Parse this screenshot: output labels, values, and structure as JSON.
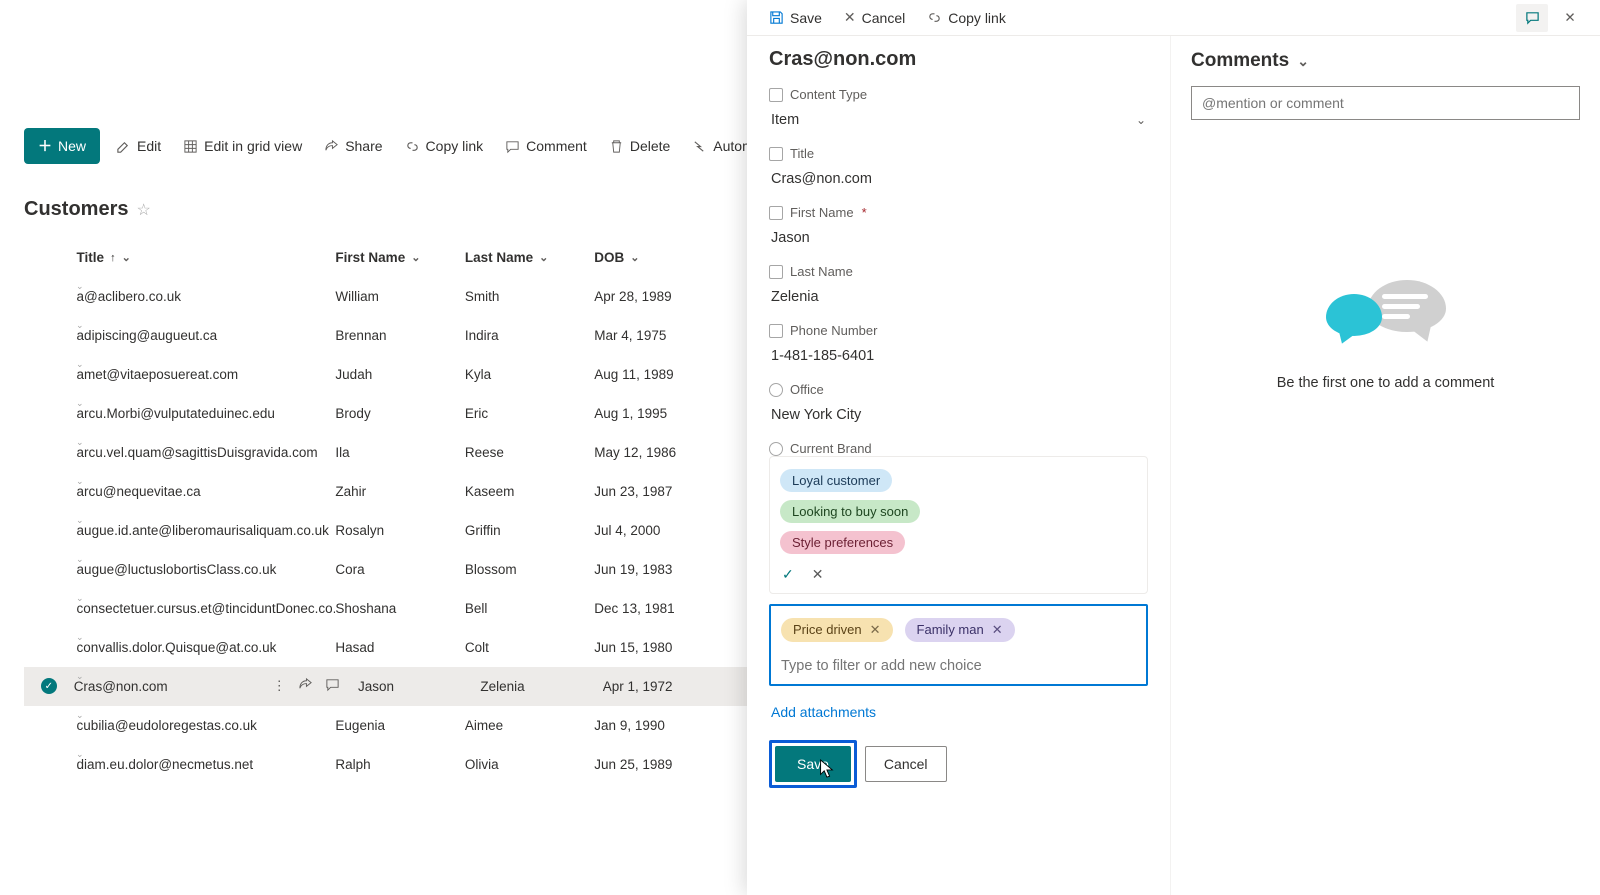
{
  "toolbar": {
    "new_label": "New",
    "edit_label": "Edit",
    "grid_label": "Edit in grid view",
    "share_label": "Share",
    "copylink_label": "Copy link",
    "comment_label": "Comment",
    "delete_label": "Delete",
    "automate_label": "Automate"
  },
  "list": {
    "title": "Customers",
    "columns": {
      "title": "Title",
      "first_name": "First Name",
      "last_name": "Last Name",
      "dob": "DOB"
    },
    "rows": [
      {
        "title": "a@aclibero.co.uk",
        "first_name": "William",
        "last_name": "Smith",
        "dob": "Apr 28, 1989"
      },
      {
        "title": "adipiscing@augueut.ca",
        "first_name": "Brennan",
        "last_name": "Indira",
        "dob": "Mar 4, 1975"
      },
      {
        "title": "amet@vitaeposuereat.com",
        "first_name": "Judah",
        "last_name": "Kyla",
        "dob": "Aug 11, 1989"
      },
      {
        "title": "arcu.Morbi@vulputateduinec.edu",
        "first_name": "Brody",
        "last_name": "Eric",
        "dob": "Aug 1, 1995"
      },
      {
        "title": "arcu.vel.quam@sagittisDuisgravida.com",
        "first_name": "Ila",
        "last_name": "Reese",
        "dob": "May 12, 1986"
      },
      {
        "title": "arcu@nequevitae.ca",
        "first_name": "Zahir",
        "last_name": "Kaseem",
        "dob": "Jun 23, 1987"
      },
      {
        "title": "augue.id.ante@liberomaurisaliquam.co.uk",
        "first_name": "Rosalyn",
        "last_name": "Griffin",
        "dob": "Jul 4, 2000"
      },
      {
        "title": "augue@luctuslobortisClass.co.uk",
        "first_name": "Cora",
        "last_name": "Blossom",
        "dob": "Jun 19, 1983"
      },
      {
        "title": "consectetuer.cursus.et@tinciduntDonec.co.uk",
        "first_name": "Shoshana",
        "last_name": "Bell",
        "dob": "Dec 13, 1981"
      },
      {
        "title": "convallis.dolor.Quisque@at.co.uk",
        "first_name": "Hasad",
        "last_name": "Colt",
        "dob": "Jun 15, 1980"
      },
      {
        "title": "Cras@non.com",
        "first_name": "Jason",
        "last_name": "Zelenia",
        "dob": "Apr 1, 1972",
        "selected": true
      },
      {
        "title": "cubilia@eudoloregestas.co.uk",
        "first_name": "Eugenia",
        "last_name": "Aimee",
        "dob": "Jan 9, 1990"
      },
      {
        "title": "diam.eu.dolor@necmetus.net",
        "first_name": "Ralph",
        "last_name": "Olivia",
        "dob": "Jun 25, 1989"
      }
    ]
  },
  "panel": {
    "top": {
      "save_label": "Save",
      "cancel_label": "Cancel",
      "copylink_label": "Copy link"
    },
    "item_title": "Cras@non.com",
    "fields": {
      "content_type": {
        "label": "Content Type",
        "value": "Item"
      },
      "title": {
        "label": "Title",
        "value": "Cras@non.com"
      },
      "first_name": {
        "label": "First Name",
        "value": "Jason",
        "required": true
      },
      "last_name": {
        "label": "Last Name",
        "value": "Zelenia"
      },
      "phone": {
        "label": "Phone Number",
        "value": "1-481-185-6401"
      },
      "office": {
        "label": "Office",
        "value": "New York City"
      },
      "current_brand": {
        "label": "Current Brand"
      }
    },
    "tag_options": [
      "Loyal customer",
      "Looking to buy soon",
      "Style preferences"
    ],
    "selected_tags": [
      "Price driven",
      "Family man"
    ],
    "tag_placeholder": "Type to filter or add new choice",
    "add_attachments": "Add attachments",
    "buttons": {
      "save": "Save",
      "cancel": "Cancel"
    }
  },
  "comments": {
    "heading": "Comments",
    "placeholder": "@mention or comment",
    "empty_text": "Be the first one to add a comment"
  }
}
